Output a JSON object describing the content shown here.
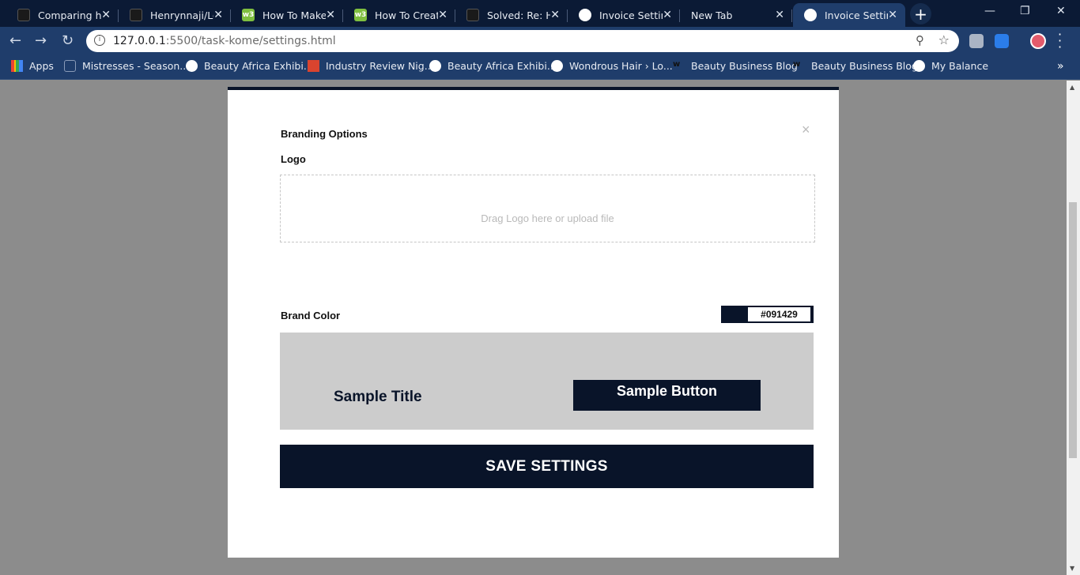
{
  "browser": {
    "tabs": [
      {
        "title": "Comparing hng",
        "icon": "github-icon"
      },
      {
        "title": "Henrynnaji/Log",
        "icon": "github-icon"
      },
      {
        "title": "How To Make",
        "icon": "w3schools-icon"
      },
      {
        "title": "How To Create",
        "icon": "w3schools-icon"
      },
      {
        "title": "Solved: Re: How",
        "icon": "github-icon"
      },
      {
        "title": "Invoice Settings",
        "icon": "globe-icon"
      },
      {
        "title": "New Tab",
        "icon": ""
      },
      {
        "title": "Invoice Settings",
        "icon": "globe-icon",
        "active": true
      }
    ],
    "url_host": "127.0.0.1",
    "url_path": ":5500/task-kome/settings.html",
    "bookmarks": [
      {
        "label": "Apps"
      },
      {
        "label": "Mistresses - Season..."
      },
      {
        "label": "Beauty Africa Exhibi..."
      },
      {
        "label": "Industry Review Nig..."
      },
      {
        "label": "Beauty Africa Exhibi..."
      },
      {
        "label": "Wondrous Hair › Lo..."
      },
      {
        "label": "Beauty Business Blog"
      },
      {
        "label": "Beauty Business Blog"
      },
      {
        "label": "My Balance"
      }
    ]
  },
  "modal": {
    "heading": "Branding Options",
    "close_glyph": "×",
    "logo_label": "Logo",
    "dropzone_text": "Drag Logo here or upload file",
    "brand_color_label": "Brand Color",
    "brand_color_value": "#091429",
    "preview": {
      "title": "Sample Title",
      "button_label": "Sample Button"
    },
    "save_label": "SAVE SETTINGS"
  },
  "colors": {
    "brand": "#091429",
    "preview_bg": "#cccccc",
    "overlay": "#8c8c8c"
  }
}
